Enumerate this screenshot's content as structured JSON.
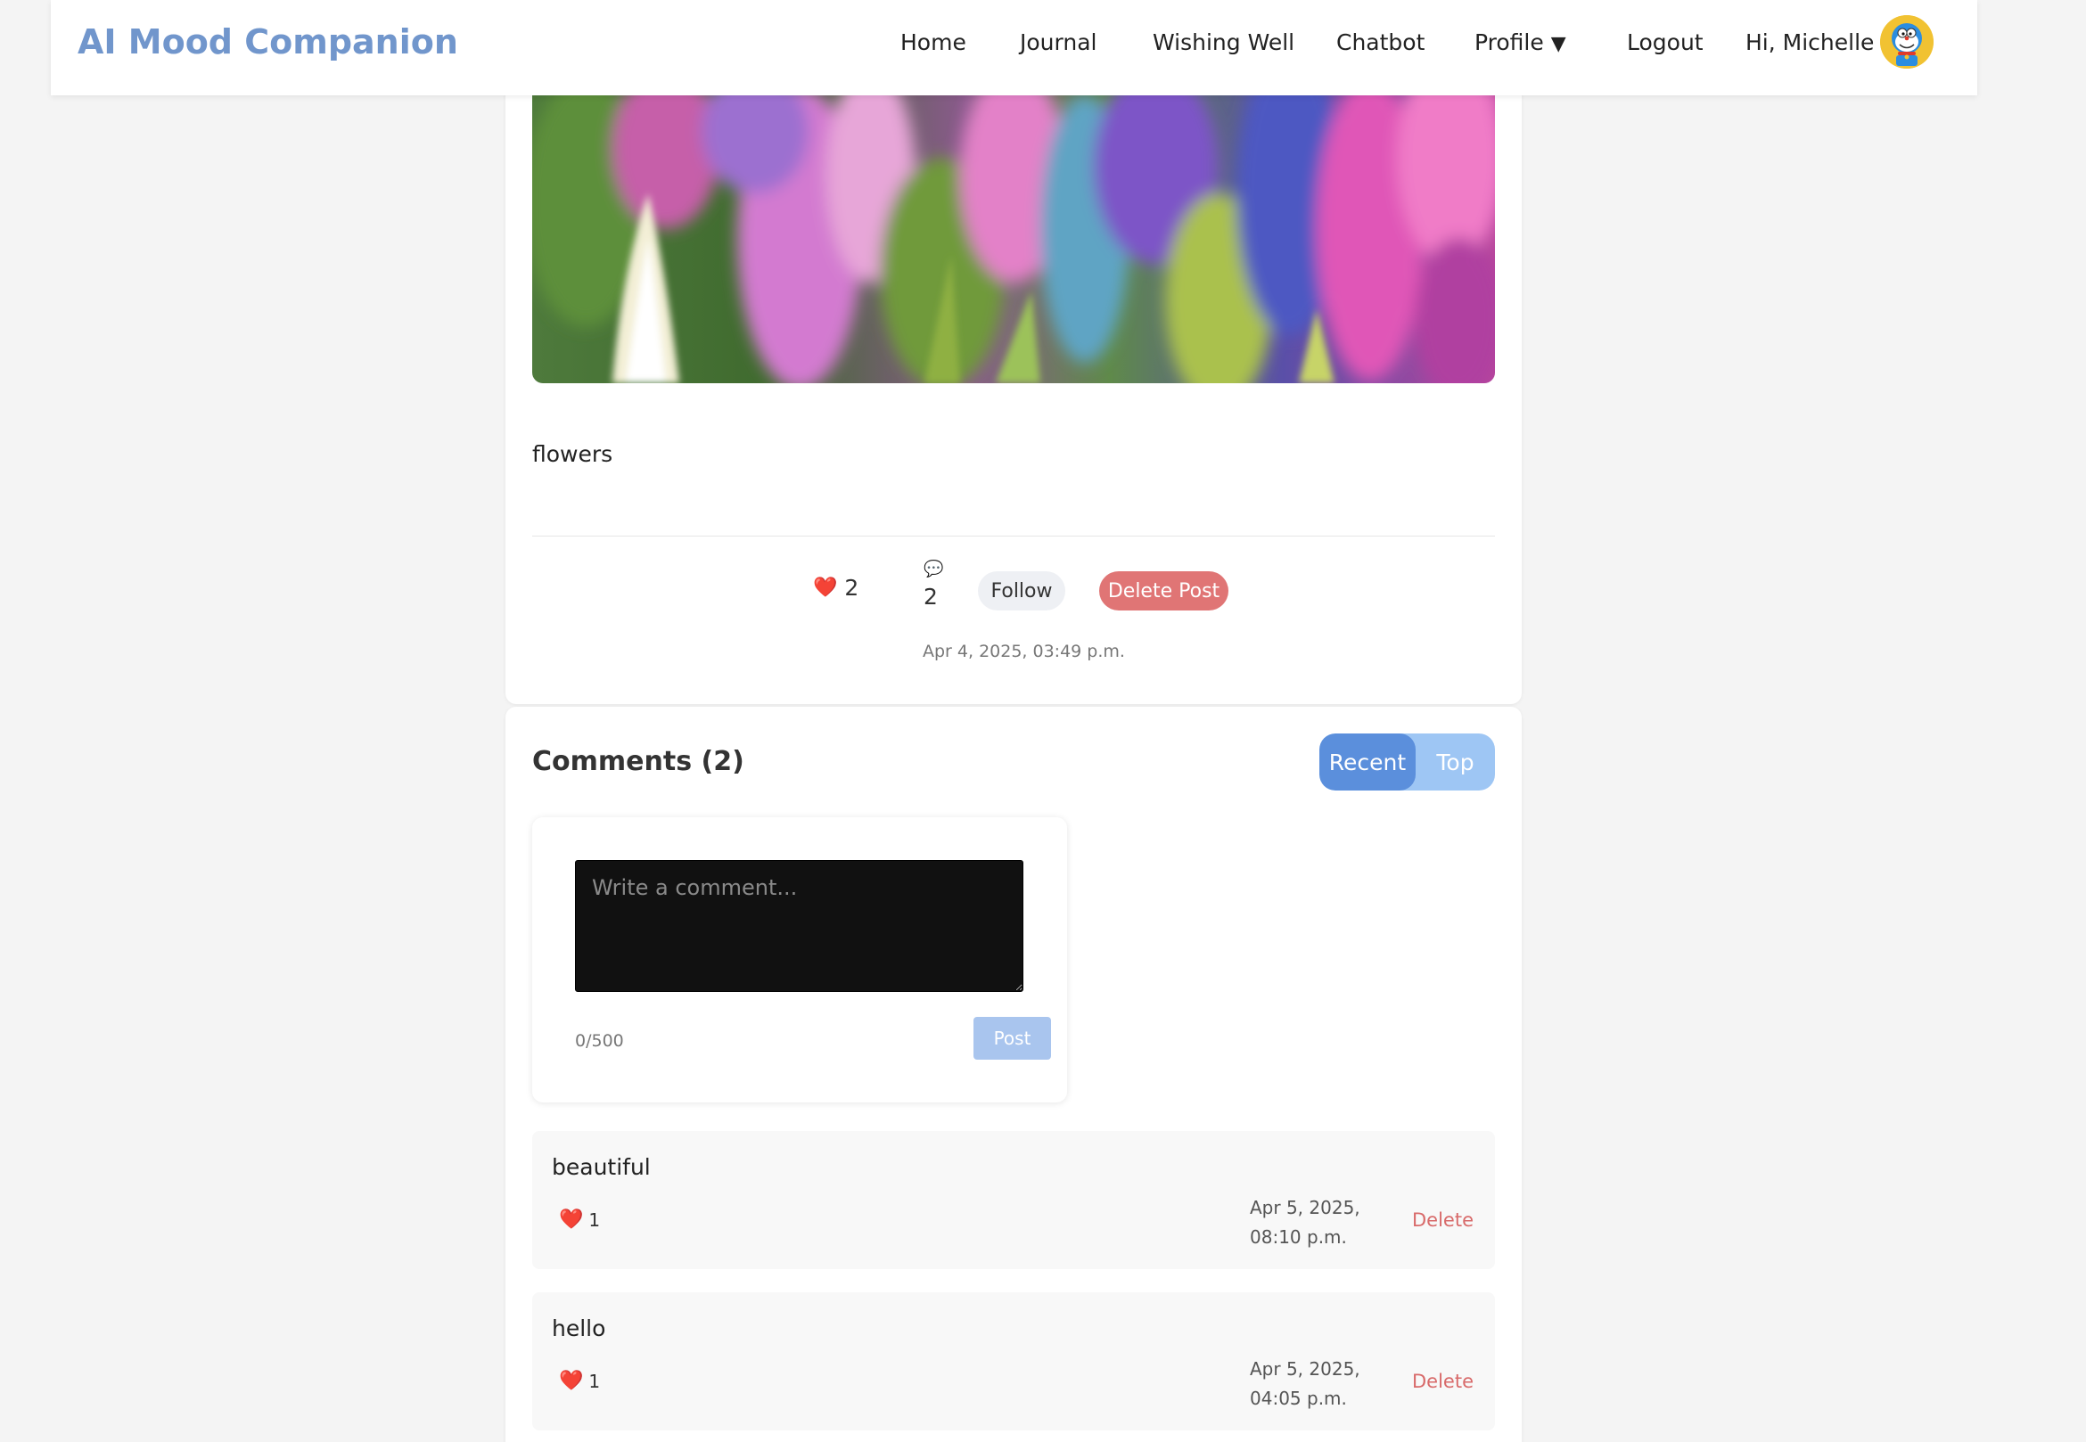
{
  "brand": "AI Mood Companion",
  "nav": {
    "home": "Home",
    "journal": "Journal",
    "wishing_well": "Wishing Well",
    "chatbot": "Chatbot",
    "profile": "Profile",
    "profile_caret": "▼",
    "logout": "Logout",
    "greeting": "Hi, Michelle"
  },
  "post": {
    "text": "flowers",
    "likes": "2",
    "comments": "2",
    "follow_label": "Follow",
    "delete_label": "Delete Post",
    "date": "Apr 4, 2025, 03:49 p.m."
  },
  "comments": {
    "title": "Comments (2)",
    "sort_recent": "Recent",
    "sort_top": "Top",
    "placeholder": "Write a comment...",
    "char_count": "0/500",
    "post_label": "Post",
    "items": [
      {
        "text": "beautiful",
        "likes": "1",
        "date": "Apr 5, 2025, 08:10 p.m.",
        "delete_label": "Delete"
      },
      {
        "text": "hello",
        "likes": "1",
        "date": "Apr 5, 2025, 04:05 p.m.",
        "delete_label": "Delete"
      }
    ]
  },
  "icons": {
    "like": "heart-icon",
    "comment": "speech-bubble-icon",
    "caret": "caret-down-icon",
    "avatar": "cartoon-avatar"
  },
  "colors": {
    "brand": "#7196cc",
    "delete_button": "#e07575",
    "sort_active": "#5b8fdc",
    "sort_inactive": "#9ec6f4",
    "post_button": "#a9c5ee",
    "delete_link": "#d86a6a"
  }
}
